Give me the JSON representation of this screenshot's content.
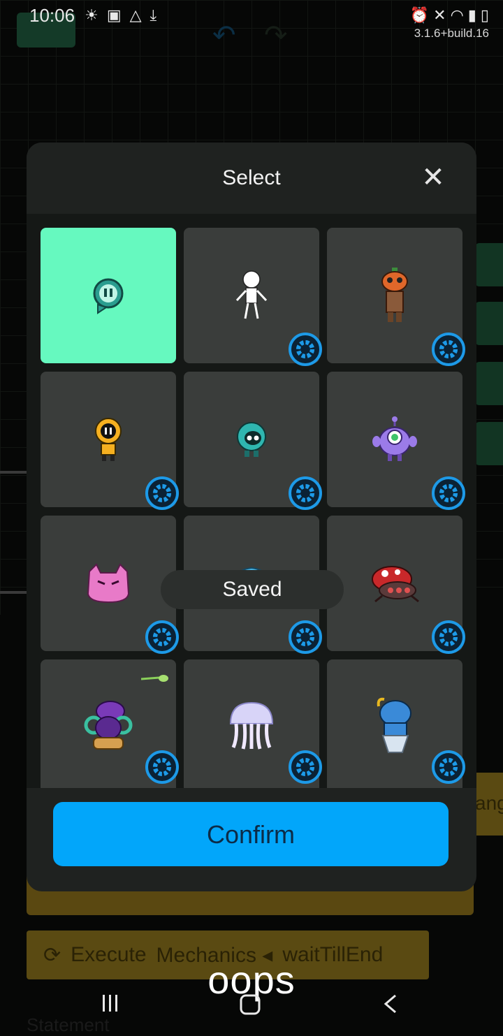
{
  "status_bar": {
    "time": "10:06",
    "build": "3.1.6+build.16"
  },
  "background_app": {
    "toolbar": {
      "execute_label": "Execute",
      "mechanics_label": "Mechanics",
      "wait_label": "waitTillEnd"
    },
    "side_peek_text": "ang",
    "statement_label": "Statement"
  },
  "dialog": {
    "title": "Select",
    "toast": "Saved",
    "confirm_label": "Confirm",
    "sprites": [
      {
        "name": "green-chat-bot",
        "selected": true,
        "has_settings": false
      },
      {
        "name": "stick-figure",
        "selected": false,
        "has_settings": true
      },
      {
        "name": "pumpkin-head",
        "selected": false,
        "has_settings": true
      },
      {
        "name": "yellow-hooded-bot",
        "selected": false,
        "has_settings": true
      },
      {
        "name": "teal-round-bot",
        "selected": false,
        "has_settings": true
      },
      {
        "name": "purple-alien",
        "selected": false,
        "has_settings": true
      },
      {
        "name": "pink-cat-blob",
        "selected": false,
        "has_settings": true
      },
      {
        "name": "blue-slime",
        "selected": false,
        "has_settings": true
      },
      {
        "name": "red-crab",
        "selected": false,
        "has_settings": true
      },
      {
        "name": "purple-snake",
        "selected": false,
        "has_settings": true
      },
      {
        "name": "jellyfish",
        "selected": false,
        "has_settings": true
      },
      {
        "name": "blue-genie",
        "selected": false,
        "has_settings": true
      }
    ]
  },
  "video_caption": "oops",
  "colors": {
    "accent_blue": "#02a6fa",
    "selected_tile": "#66f9bf",
    "tile": "#3a3d3b",
    "dialog": "#1f2220"
  }
}
